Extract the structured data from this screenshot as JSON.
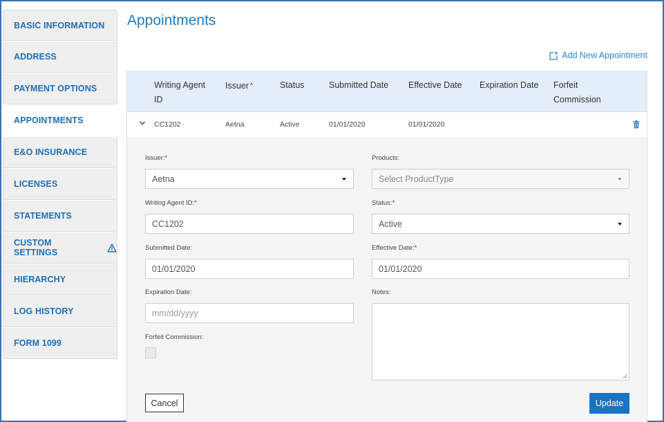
{
  "sidebar": {
    "items": [
      {
        "label": "BASIC INFORMATION"
      },
      {
        "label": "ADDRESS"
      },
      {
        "label": "PAYMENT OPTIONS"
      },
      {
        "label": "APPOINTMENTS"
      },
      {
        "label": "E&O INSURANCE"
      },
      {
        "label": "LICENSES"
      },
      {
        "label": "STATEMENTS"
      },
      {
        "label": "CUSTOM SETTINGS"
      },
      {
        "label": "HIERARCHY"
      },
      {
        "label": "LOG HISTORY"
      },
      {
        "label": "FORM 1099"
      }
    ],
    "active_item": "APPOINTMENTS",
    "warning_icon": "warning-triangle-icon"
  },
  "main": {
    "title": "Appointments",
    "add_link": "Add New Appointment",
    "table": {
      "headers": [
        "Writing Agent ID",
        "Issuer",
        "Status",
        "Submitted Date",
        "Effective Date",
        "Expiration Date",
        "Forfeit Commission"
      ],
      "sorted_column": "Issuer",
      "rows": [
        {
          "writing_agent_id": "CC1202",
          "issuer": "Aetna",
          "status": "Active",
          "submitted_date": "01/01/2020",
          "effective_date": "01/01/2020",
          "expiration_date": "",
          "forfeit_commission": ""
        }
      ]
    },
    "form": {
      "issuer_label": "Issuer:*",
      "issuer_value": "Aetna",
      "products_label": "Products:",
      "products_placeholder": "Select ProductType",
      "writing_agent_label": "Writing Agent ID:*",
      "writing_agent_value": "CC1202",
      "status_label": "Status:*",
      "status_value": "Active",
      "submitted_label": "Submitted Date:",
      "submitted_value": "01/01/2020",
      "effective_label": "Effective Date:*",
      "effective_value": "01/01/2020",
      "expiration_label": "Expiration Date:",
      "expiration_placeholder": "mm/dd/yyyy",
      "notes_label": "Notes:",
      "notes_value": "",
      "forfeit_label": "Forfeit Commission:",
      "forfeit_checked": false,
      "cancel_label": "Cancel",
      "update_label": "Update"
    }
  },
  "colors": {
    "accent": "#1f7cc4",
    "header_bg": "#e3eef9",
    "update_button": "#1a74c4",
    "warning": "#1d6fb8"
  }
}
